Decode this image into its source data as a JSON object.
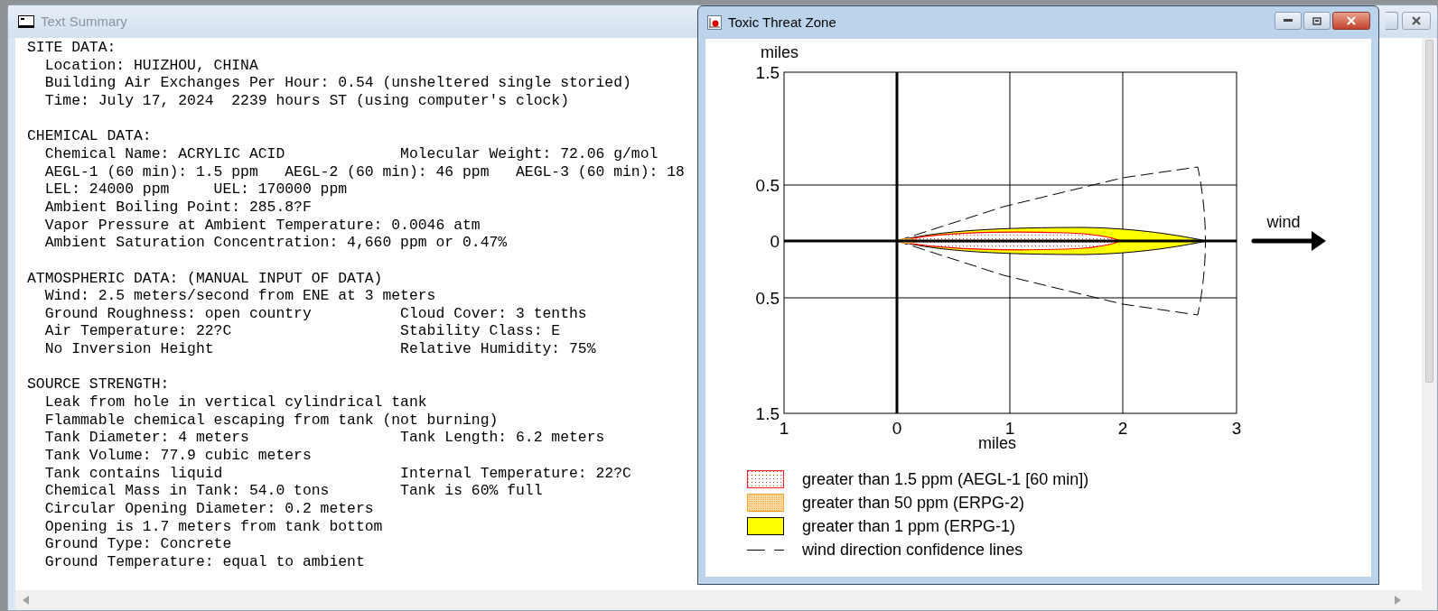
{
  "summary_window": {
    "title": "Text Summary",
    "sections": [
      {
        "heading": "SITE DATA:",
        "lines": [
          {
            "text": "Location: HUIZHOU, CHINA"
          },
          {
            "text": "Building Air Exchanges Per Hour: 0.54 (unsheltered single storied)"
          },
          {
            "text": "Time: July 17, 2024  2239 hours ST (using computer's clock)"
          }
        ]
      },
      {
        "heading": "CHEMICAL DATA:",
        "lines": [
          {
            "text": "Chemical Name: ACRYLIC ACID",
            "column_2": "Molecular Weight: 72.06 g/mol"
          },
          {
            "text": "AEGL-1 (60 min): 1.5 ppm   AEGL-2 (60 min): 46 ppm   AEGL-3 (60 min): 18"
          },
          {
            "text": "LEL: 24000 ppm     UEL: 170000 ppm"
          },
          {
            "text": "Ambient Boiling Point: 285.8?F"
          },
          {
            "text": "Vapor Pressure at Ambient Temperature: 0.0046 atm"
          },
          {
            "text": "Ambient Saturation Concentration: 4,660 ppm or 0.47%"
          }
        ]
      },
      {
        "heading": "ATMOSPHERIC DATA: (MANUAL INPUT OF DATA)",
        "lines": [
          {
            "text": "Wind: 2.5 meters/second from ENE at 3 meters"
          },
          {
            "text": "Ground Roughness: open country",
            "column_2": "Cloud Cover: 3 tenths"
          },
          {
            "text": "Air Temperature: 22?C",
            "column_2": "Stability Class: E"
          },
          {
            "text": "No Inversion Height",
            "column_2": "Relative Humidity: 75%"
          }
        ]
      },
      {
        "heading": "SOURCE STRENGTH:",
        "lines": [
          {
            "text": "Leak from hole in vertical cylindrical tank"
          },
          {
            "text": "Flammable chemical escaping from tank (not burning)"
          },
          {
            "text": "Tank Diameter: 4 meters",
            "column_2": "Tank Length: 6.2 meters"
          },
          {
            "text": "Tank Volume: 77.9 cubic meters"
          },
          {
            "text": "Tank contains liquid",
            "column_2": "Internal Temperature: 22?C"
          },
          {
            "text": "Chemical Mass in Tank: 54.0 tons",
            "column_2": "Tank is 60% full"
          },
          {
            "text": "Circular Opening Diameter: 0.2 meters"
          },
          {
            "text": "Opening is 1.7 meters from tank bottom"
          },
          {
            "text": "Ground Type: Concrete"
          },
          {
            "text": "Ground Temperature: equal to ambient"
          }
        ]
      }
    ]
  },
  "threat_window": {
    "title": "Toxic Threat Zone",
    "plot": {
      "y_unit": "miles",
      "y_ticks": [
        "1.5",
        "0.5",
        "0",
        "0.5",
        "1.5"
      ],
      "x_ticks": [
        "1",
        "0",
        "1",
        "2",
        "3"
      ],
      "x_unit": "miles",
      "wind_label": "wind"
    },
    "legend": [
      {
        "kind": "red-dots",
        "label": "greater than 1.5 ppm (AEGL-1 [60 min])"
      },
      {
        "kind": "orange-dots",
        "label": "greater than 50 ppm (ERPG-2)"
      },
      {
        "kind": "yellow-fill",
        "label": "greater than 1 ppm (ERPG-1)"
      },
      {
        "kind": "dashed-line",
        "label": "wind direction confidence lines"
      }
    ]
  }
}
